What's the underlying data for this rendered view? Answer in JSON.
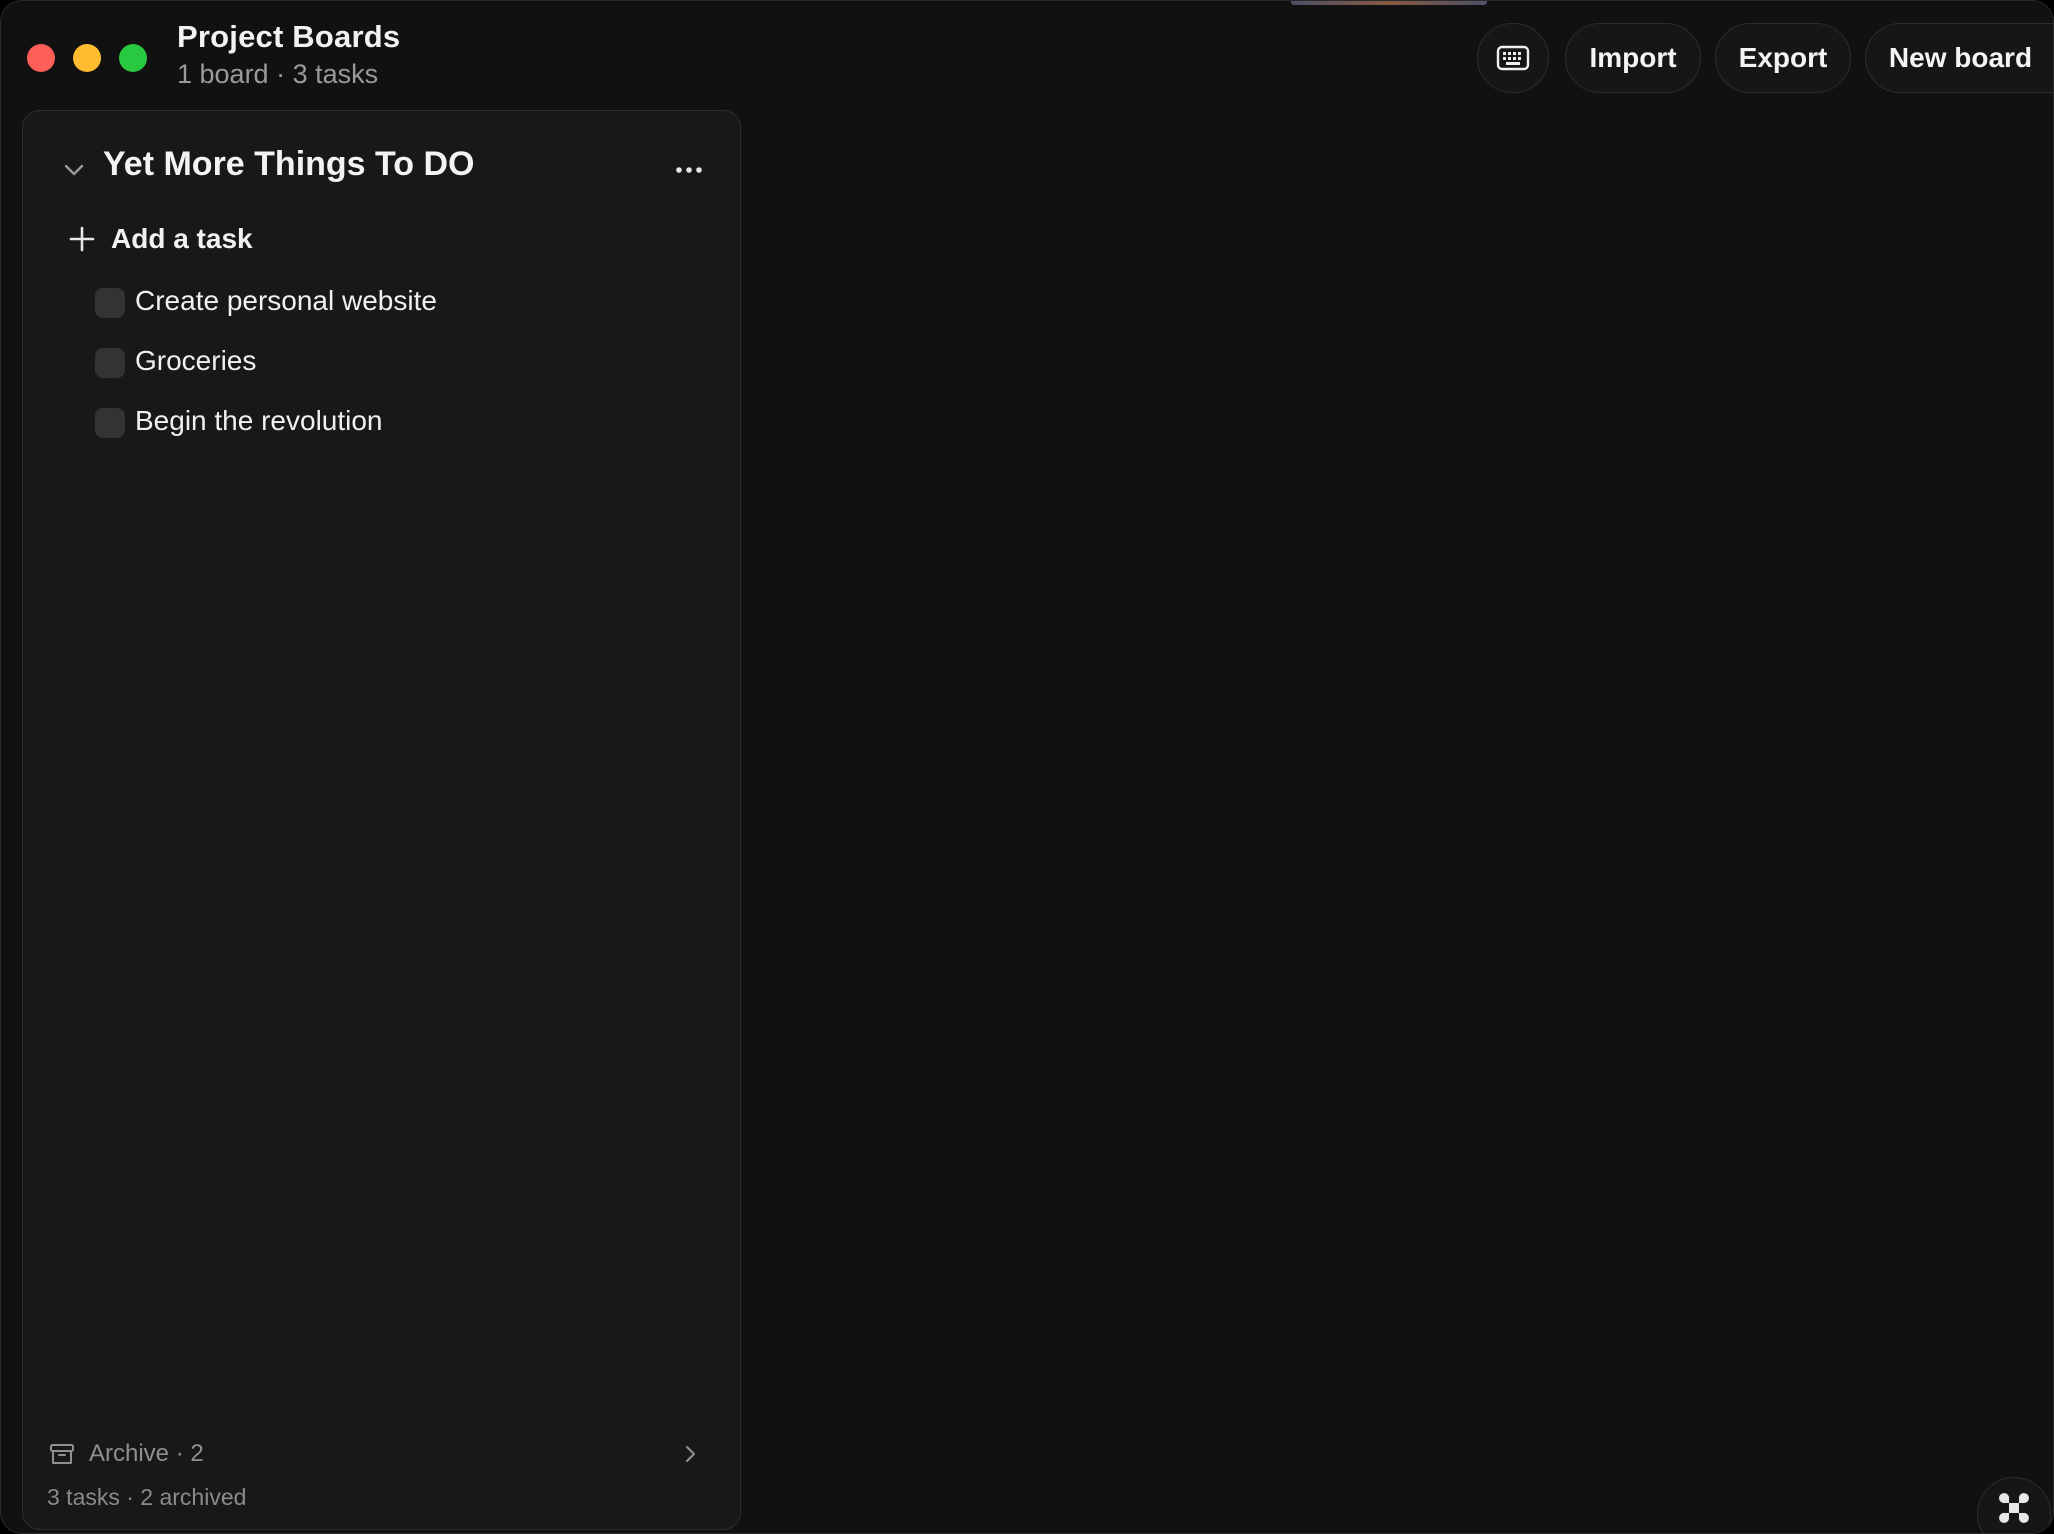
{
  "window": {
    "title": "Project Boards",
    "subtitle": "1 board · 3 tasks"
  },
  "toolbar": {
    "keyboard_icon": "keyboard-icon",
    "import_label": "Import",
    "export_label": "Export",
    "new_board_label": "New board"
  },
  "board": {
    "title": "Yet More Things To DO",
    "collapse_icon": "chevron-down-icon",
    "menu_icon": "more-horizontal-icon",
    "add_task_label": "Add a task",
    "tasks": [
      {
        "label": "Create personal website",
        "done": false
      },
      {
        "label": "Groceries",
        "done": false
      },
      {
        "label": "Begin the revolution",
        "done": false
      }
    ],
    "archive_label": "Archive · 2",
    "footer_stats": "3 tasks · 2 archived"
  },
  "colors": {
    "background": "#111111",
    "panel": "#181818",
    "traffic_red": "#ff5f57",
    "traffic_yellow": "#febc2e",
    "traffic_green": "#28c840"
  }
}
